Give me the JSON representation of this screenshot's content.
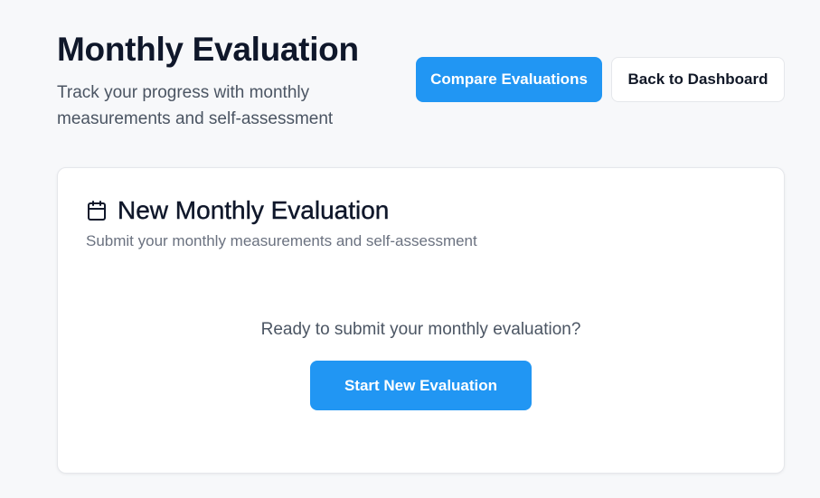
{
  "header": {
    "title": "Monthly Evaluation",
    "subtitle": "Track your progress with monthly measurements and self-assessment"
  },
  "actions": {
    "compare_label": "Compare Evaluations",
    "back_label": "Back to Dashboard"
  },
  "card": {
    "icon": "calendar-icon",
    "title": "New Monthly Evaluation",
    "subtitle": "Submit your monthly measurements and self-assessment",
    "prompt": "Ready to submit your monthly evaluation?",
    "start_label": "Start New Evaluation"
  },
  "colors": {
    "primary": "#2196f3",
    "background": "#f7f8fa",
    "card": "#ffffff",
    "heading": "#0f172a",
    "muted": "#6b7280"
  }
}
